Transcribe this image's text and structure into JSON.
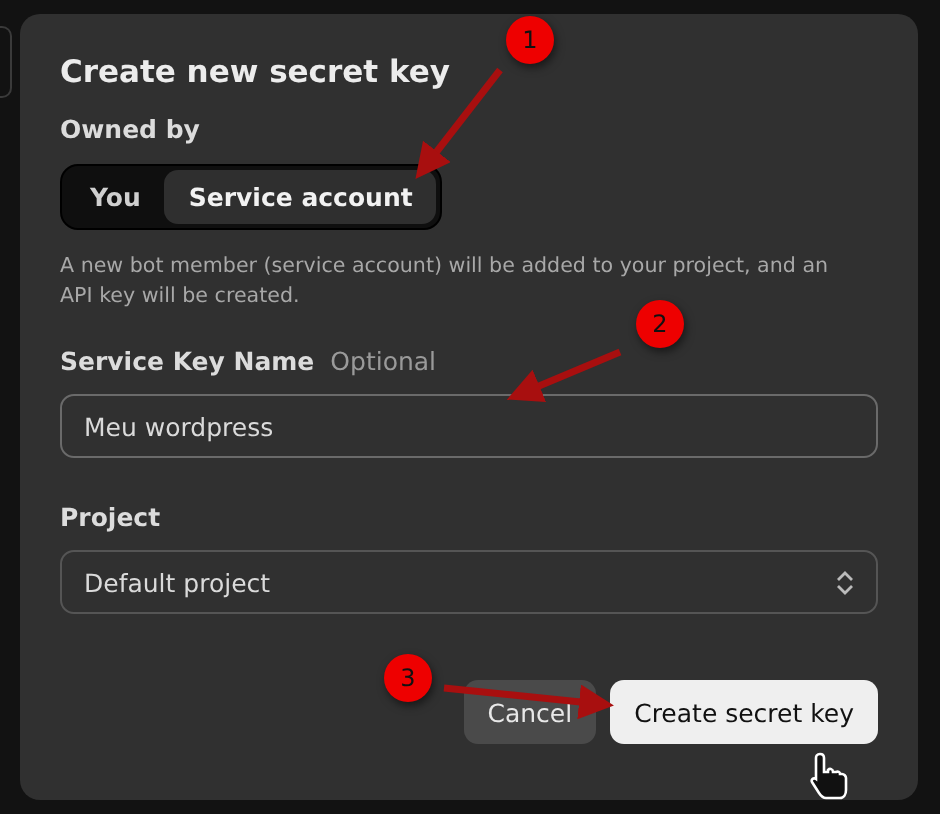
{
  "dialog": {
    "title": "Create new secret key",
    "owned_by": {
      "label": "Owned by",
      "options": [
        {
          "label": "You",
          "selected": false
        },
        {
          "label": "Service account",
          "selected": true
        }
      ]
    },
    "description": "A new bot member (service account) will be added to your project, and an API key will be created.",
    "name_field": {
      "label": "Service Key Name",
      "hint": "Optional",
      "value": "Meu wordpress"
    },
    "project": {
      "label": "Project",
      "value": "Default project"
    },
    "buttons": [
      {
        "label": "Cancel",
        "kind": "secondary"
      },
      {
        "label": "Create secret key",
        "kind": "primary"
      }
    ]
  },
  "annotations": [
    {
      "number": "1"
    },
    {
      "number": "2"
    },
    {
      "number": "3"
    }
  ]
}
